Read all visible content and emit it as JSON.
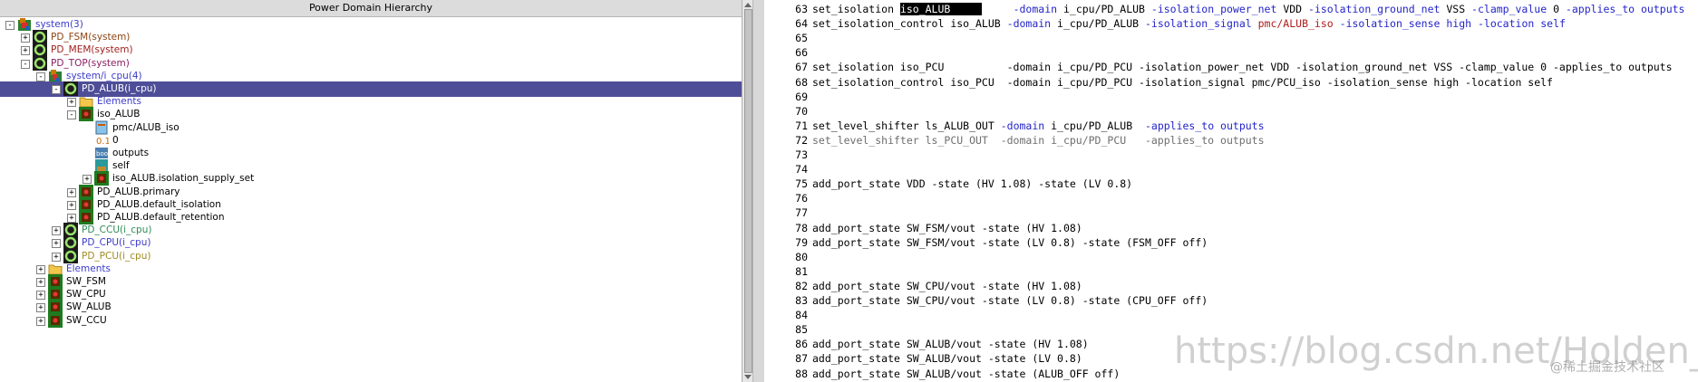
{
  "left_panel": {
    "title": "Power Domain Hierarchy"
  },
  "tree": [
    {
      "depth": 0,
      "expander": "-",
      "icon": "cpu",
      "label": "system(3)",
      "color": "c-sys"
    },
    {
      "depth": 1,
      "expander": "+",
      "icon": "ring",
      "label": "PD_FSM(system)",
      "color": "c-fsm"
    },
    {
      "depth": 1,
      "expander": "+",
      "icon": "ring",
      "label": "PD_MEM(system)",
      "color": "c-mem"
    },
    {
      "depth": 1,
      "expander": "-",
      "icon": "ring",
      "label": "PD_TOP(system)",
      "color": "c-top"
    },
    {
      "depth": 2,
      "expander": "-",
      "icon": "cpu",
      "label": "system/i_cpu(4)",
      "color": "c-sys"
    },
    {
      "depth": 3,
      "expander": "-",
      "icon": "ring",
      "label": "PD_ALUB(i_cpu)",
      "color": "c-blk",
      "selected": true
    },
    {
      "depth": 4,
      "expander": "+",
      "icon": "folder",
      "label": "Elements",
      "color": "c-sys"
    },
    {
      "depth": 4,
      "expander": "-",
      "icon": "chip",
      "label": "iso_ALUB",
      "color": "c-blk"
    },
    {
      "depth": 5,
      "expander": "",
      "icon": "doc",
      "label": "pmc/ALUB_iso",
      "color": "c-blk"
    },
    {
      "depth": 5,
      "expander": "",
      "icon": "num",
      "label": "0",
      "color": "c-blk"
    },
    {
      "depth": 5,
      "expander": "",
      "icon": "gear",
      "label": "outputs",
      "color": "c-blk"
    },
    {
      "depth": 5,
      "expander": "",
      "icon": "self",
      "label": "self",
      "color": "c-blk"
    },
    {
      "depth": 5,
      "expander": "+",
      "icon": "chip",
      "label": "iso_ALUB.isolation_supply_set",
      "color": "c-blk"
    },
    {
      "depth": 4,
      "expander": "+",
      "icon": "chip",
      "label": "PD_ALUB.primary",
      "color": "c-blk"
    },
    {
      "depth": 4,
      "expander": "+",
      "icon": "chip",
      "label": "PD_ALUB.default_isolation",
      "color": "c-blk"
    },
    {
      "depth": 4,
      "expander": "+",
      "icon": "chip",
      "label": "PD_ALUB.default_retention",
      "color": "c-blk"
    },
    {
      "depth": 3,
      "expander": "+",
      "icon": "ring",
      "label": "PD_CCU(i_cpu)",
      "color": "c-ccu"
    },
    {
      "depth": 3,
      "expander": "+",
      "icon": "ring",
      "label": "PD_CPU(i_cpu)",
      "color": "c-cpu"
    },
    {
      "depth": 3,
      "expander": "+",
      "icon": "ring",
      "label": "PD_PCU(i_cpu)",
      "color": "c-pcu"
    },
    {
      "depth": 2,
      "expander": "+",
      "icon": "folder",
      "label": "Elements",
      "color": "c-sys"
    },
    {
      "depth": 2,
      "expander": "+",
      "icon": "chip",
      "label": "SW_FSM",
      "color": "c-blk"
    },
    {
      "depth": 2,
      "expander": "+",
      "icon": "chip",
      "label": "SW_CPU",
      "color": "c-blk"
    },
    {
      "depth": 2,
      "expander": "+",
      "icon": "chip",
      "label": "SW_ALUB",
      "color": "c-blk"
    },
    {
      "depth": 2,
      "expander": "+",
      "icon": "chip",
      "label": "SW_CCU",
      "color": "c-blk"
    }
  ],
  "code": [
    {
      "num": "63",
      "seg": [
        {
          "t": "set_isolation "
        },
        {
          "t": "iso_ALUB     ",
          "c": "hl"
        },
        {
          "t": "     "
        },
        {
          "t": "-domain",
          "c": "kw"
        },
        {
          "t": " i_cpu/PD_ALUB "
        },
        {
          "t": "-isolation_power_net",
          "c": "kw"
        },
        {
          "t": " VDD "
        },
        {
          "t": "-isolation_ground_net",
          "c": "kw"
        },
        {
          "t": " VSS "
        },
        {
          "t": "-clamp_value",
          "c": "kw"
        },
        {
          "t": " 0 "
        },
        {
          "t": "-applies_to outputs",
          "c": "kw"
        }
      ]
    },
    {
      "num": "64",
      "seg": [
        {
          "t": "set_isolation_control iso_ALUB "
        },
        {
          "t": "-domain",
          "c": "kw"
        },
        {
          "t": " i_cpu/PD_ALUB "
        },
        {
          "t": "-isolation_signal",
          "c": "kw"
        },
        {
          "t": " "
        },
        {
          "t": "pmc/ALUB_iso",
          "c": "sig"
        },
        {
          "t": " "
        },
        {
          "t": "-isolation_sense high",
          "c": "kw"
        },
        {
          "t": " "
        },
        {
          "t": "-location self",
          "c": "kw"
        }
      ]
    },
    {
      "num": "65",
      "seg": []
    },
    {
      "num": "66",
      "seg": []
    },
    {
      "num": "67",
      "seg": [
        {
          "t": "set_isolation iso_PCU          -domain i_cpu/PD_PCU -isolation_power_net VDD -isolation_ground_net VSS -clamp_value 0 -applies_to outputs"
        }
      ]
    },
    {
      "num": "68",
      "seg": [
        {
          "t": "set_isolation_control iso_PCU  -domain i_cpu/PD_PCU -isolation_signal pmc/PCU_iso -isolation_sense high -location self"
        }
      ]
    },
    {
      "num": "69",
      "seg": []
    },
    {
      "num": "70",
      "seg": []
    },
    {
      "num": "71",
      "seg": [
        {
          "t": "set_level_shifter ls_ALUB_OUT "
        },
        {
          "t": "-domain",
          "c": "kw"
        },
        {
          "t": " i_cpu/PD_ALUB  "
        },
        {
          "t": "-applies_to outputs",
          "c": "kw"
        }
      ]
    },
    {
      "num": "72",
      "seg": [
        {
          "t": "set_level_shifter ls_PCU_OUT  -domain i_cpu/PD_PCU   -applies_to outputs",
          "c": "gray"
        }
      ]
    },
    {
      "num": "73",
      "seg": []
    },
    {
      "num": "74",
      "seg": []
    },
    {
      "num": "75",
      "seg": [
        {
          "t": "add_port_state VDD -state (HV 1.08) -state (LV 0.8)"
        }
      ]
    },
    {
      "num": "76",
      "seg": []
    },
    {
      "num": "77",
      "seg": []
    },
    {
      "num": "78",
      "seg": [
        {
          "t": "add_port_state SW_FSM/vout -state (HV 1.08)"
        }
      ]
    },
    {
      "num": "79",
      "seg": [
        {
          "t": "add_port_state SW_FSM/vout -state (LV 0.8) -state (FSM_OFF off)"
        }
      ]
    },
    {
      "num": "80",
      "seg": []
    },
    {
      "num": "81",
      "seg": []
    },
    {
      "num": "82",
      "seg": [
        {
          "t": "add_port_state SW_CPU/vout -state (HV 1.08)"
        }
      ]
    },
    {
      "num": "83",
      "seg": [
        {
          "t": "add_port_state SW_CPU/vout -state (LV 0.8) -state (CPU_OFF off)"
        }
      ]
    },
    {
      "num": "84",
      "seg": []
    },
    {
      "num": "85",
      "seg": []
    },
    {
      "num": "86",
      "seg": [
        {
          "t": "add_port_state SW_ALUB/vout -state (HV 1.08)"
        }
      ]
    },
    {
      "num": "87",
      "seg": [
        {
          "t": "add_port_state SW_ALUB/vout -state (LV 0.8)"
        }
      ]
    },
    {
      "num": "88",
      "seg": [
        {
          "t": "add_port_state SW_ALUB/vout -state (ALUB_OFF off)"
        }
      ]
    }
  ],
  "watermark": {
    "url": "https://blog.csdn.net/Holden_Liu",
    "credit": "@稀土掘金技术社区"
  }
}
